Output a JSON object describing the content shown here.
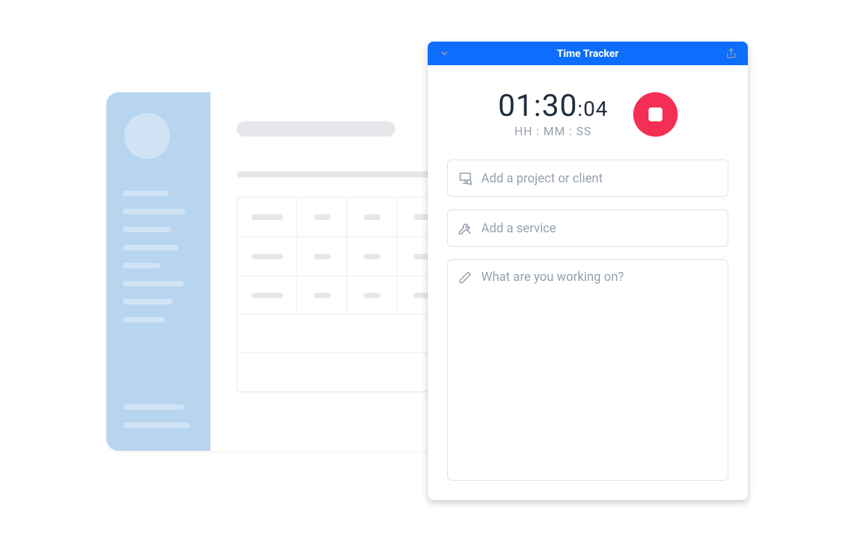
{
  "tracker": {
    "header": {
      "title": "Time Tracker"
    },
    "timer": {
      "hh": "01",
      "mm": "30",
      "ss": "04",
      "labels": "HH : MM : SS"
    },
    "fields": {
      "project_placeholder": "Add a project or client",
      "service_placeholder": "Add a service",
      "notes_placeholder": "What are you working on?"
    }
  }
}
